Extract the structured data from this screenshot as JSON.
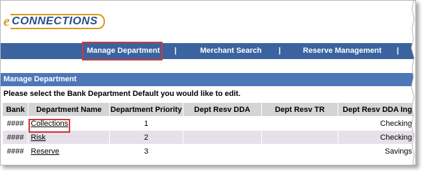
{
  "app": {
    "logo_e": "e",
    "logo_text": "CONNECTIONS"
  },
  "nav": {
    "items": [
      "Manage Department",
      "Merchant Search",
      "Reserve Management"
    ],
    "separator": "|"
  },
  "section": {
    "title": "Manage Department",
    "instructions": "Please select the Bank Department Default you would like to edit."
  },
  "table": {
    "headers": [
      "Bank",
      "Department Name",
      "Department Priority",
      "Dept Resv DDA",
      "Dept Resv TR",
      "Dept Resv DDA Ing"
    ],
    "rows": [
      {
        "bank": "####",
        "name": "Collections",
        "priority": "1",
        "dda": "",
        "tr": "",
        "dda_type": "Checking"
      },
      {
        "bank": "####",
        "name": "Risk",
        "priority": "2",
        "dda": "",
        "tr": "",
        "dda_type": "Checking"
      },
      {
        "bank": "####",
        "name": "Reserve",
        "priority": "3",
        "dda": "",
        "tr": "",
        "dda_type": "Savings"
      }
    ]
  },
  "colors": {
    "nav_bar": "#3a63a0",
    "section_header": "#4d77b7",
    "highlight": "#d43838",
    "logo_orange": "#d89a1c",
    "logo_blue": "#2b4f86"
  }
}
